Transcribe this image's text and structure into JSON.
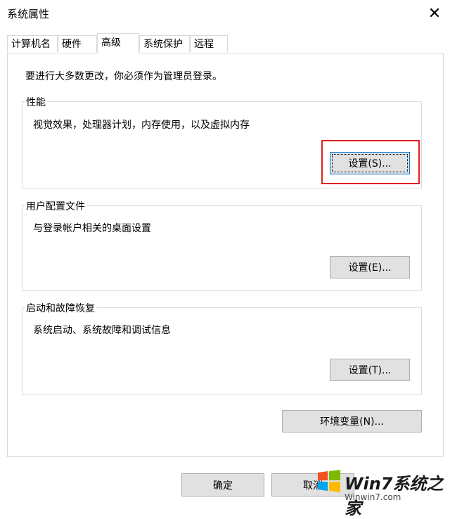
{
  "window": {
    "title": "系统属性"
  },
  "tabs": [
    {
      "label": "计算机名"
    },
    {
      "label": "硬件"
    },
    {
      "label": "高级"
    },
    {
      "label": "系统保护"
    },
    {
      "label": "远程"
    }
  ],
  "admin_notice": "要进行大多数更改，你必须作为管理员登录。",
  "performance": {
    "title": "性能",
    "desc": "视觉效果，处理器计划，内存使用，以及虚拟内存",
    "button": "设置(S)..."
  },
  "user_profiles": {
    "title": "用户配置文件",
    "desc": "与登录帐户相关的桌面设置",
    "button": "设置(E)..."
  },
  "startup_recovery": {
    "title": "启动和故障恢复",
    "desc": "系统启动、系统故障和调试信息",
    "button": "设置(T)..."
  },
  "env_button": "环境变量(N)...",
  "footer": {
    "ok": "确定",
    "cancel": "取消"
  },
  "watermark": {
    "text": "Win7系统之家",
    "url": "Winwin7.com"
  },
  "colors": {
    "highlight": "#e02020",
    "button_bg": "#e1e1e1",
    "focus_border": "#0078d7"
  }
}
